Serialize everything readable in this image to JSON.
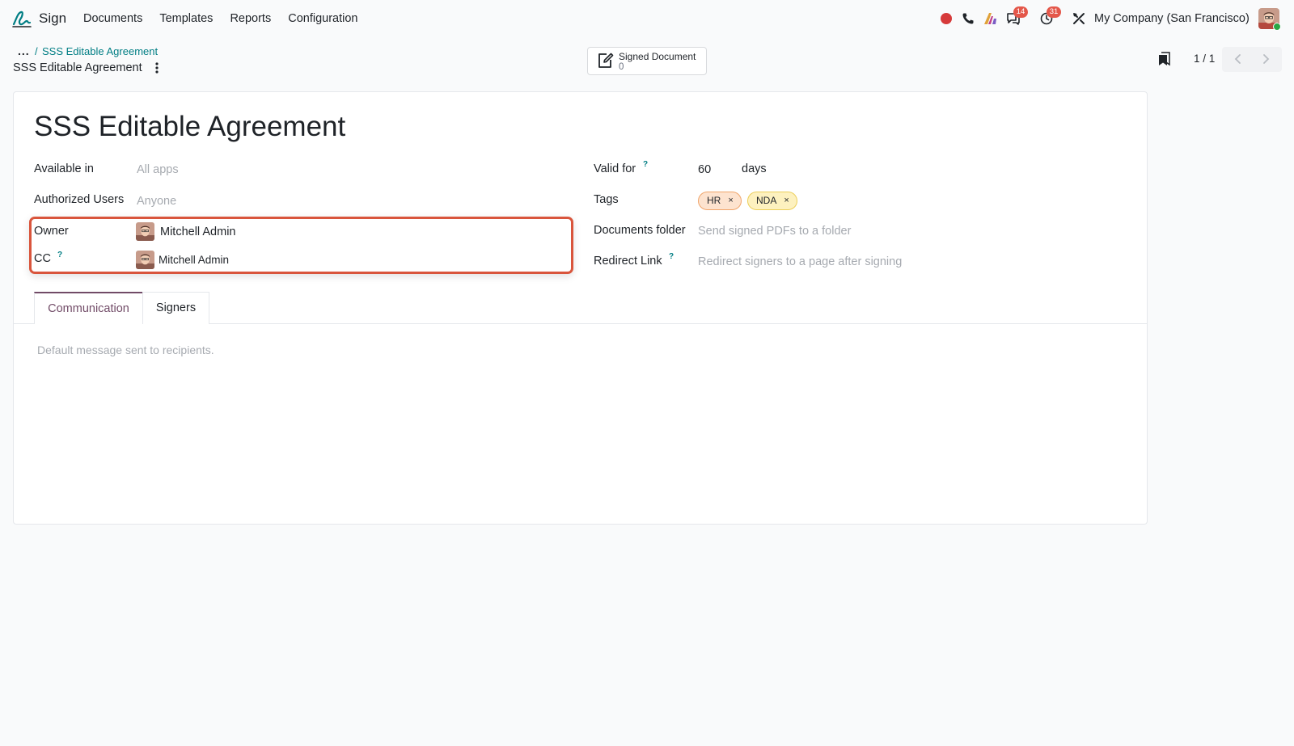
{
  "navbar": {
    "app_name": "Sign",
    "menu": [
      "Documents",
      "Templates",
      "Reports",
      "Configuration"
    ],
    "badges": {
      "messages": "14",
      "activities": "31"
    },
    "company": "My Company (San Francisco)",
    "icons": [
      "record-icon",
      "phone-icon",
      "ai-icon",
      "chat-icon",
      "clock-icon",
      "tools-icon"
    ]
  },
  "breadcrumb": {
    "dots": "...",
    "separator": "/",
    "parent": "SSS Editable Agreement",
    "current": "SSS Editable Agreement"
  },
  "smart_button": {
    "label": "Signed Document",
    "value": "0"
  },
  "pager": {
    "value": "1 / 1"
  },
  "form": {
    "title": "SSS Editable Agreement",
    "available_in": {
      "label": "Available in",
      "placeholder": "All apps"
    },
    "authorized_users": {
      "label": "Authorized Users",
      "placeholder": "Anyone"
    },
    "owner": {
      "label": "Owner",
      "value": "Mitchell Admin"
    },
    "cc": {
      "label": "CC",
      "help": "?",
      "value": "Mitchell Admin"
    },
    "valid_for": {
      "label": "Valid for",
      "help": "?",
      "value": "60",
      "unit": "days"
    },
    "tags": {
      "label": "Tags",
      "items": [
        {
          "name": "HR",
          "remove": "×",
          "bg": "#fde3cf",
          "border": "#f0a56b"
        },
        {
          "name": "NDA",
          "remove": "×",
          "bg": "#fdf1bf",
          "border": "#eccf5b"
        }
      ]
    },
    "documents_folder": {
      "label": "Documents folder",
      "placeholder": "Send signed PDFs to a folder"
    },
    "redirect_link": {
      "label": "Redirect Link",
      "help": "?",
      "placeholder": "Redirect signers to a page after signing"
    }
  },
  "notebook": {
    "tabs": [
      "Communication",
      "Signers"
    ],
    "active_tab": "Communication",
    "message_placeholder": "Default message sent to recipients."
  },
  "colors": {
    "accent": "#017e84",
    "brand": "#714b67",
    "highlight": "#d9553c"
  }
}
